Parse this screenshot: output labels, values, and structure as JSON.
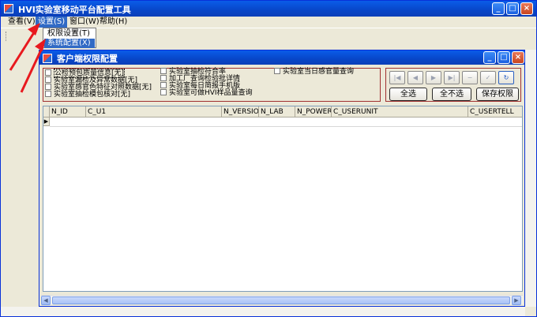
{
  "app": {
    "title": "HVI实验室移动平台配置工具",
    "window_buttons": [
      "_",
      "□",
      "×"
    ]
  },
  "menubar": {
    "items": [
      "查看(V)",
      "设置(S)",
      "窗口(W)",
      "帮助(H)"
    ]
  },
  "dropdown": {
    "items": [
      "权限设置(T)",
      "系统配置(X)"
    ]
  },
  "child_window": {
    "title": "客户端权限配置"
  },
  "permissions": [
    "公检预包质量信息[无]",
    "实验室漏检及异常数据[无]",
    "实验室感官色特征对照数据[无]",
    "实验室抽检模包核对[无]",
    "实验室抽检符合率",
    "加工厂查询检验批详情",
    "实验室每日简报手机版",
    "实验室可做HVI样品量查询",
    "实验室当日感官量查询"
  ],
  "nav_buttons": [
    "|◀",
    "◀",
    "▶",
    "▶|",
    "−",
    "✓",
    "↻"
  ],
  "action_buttons": {
    "select_all": "全选",
    "select_none": "全不选",
    "save": "保存权限"
  },
  "grid": {
    "columns": [
      "N_ID",
      "C_U1",
      "N_VERSION",
      "N_LAB",
      "N_POWER",
      "C_USERUNIT",
      "C_USERTELL"
    ],
    "row_indicator": "▶"
  },
  "icons": {
    "app": "app-icon",
    "arrow_color": "#e8191e"
  }
}
